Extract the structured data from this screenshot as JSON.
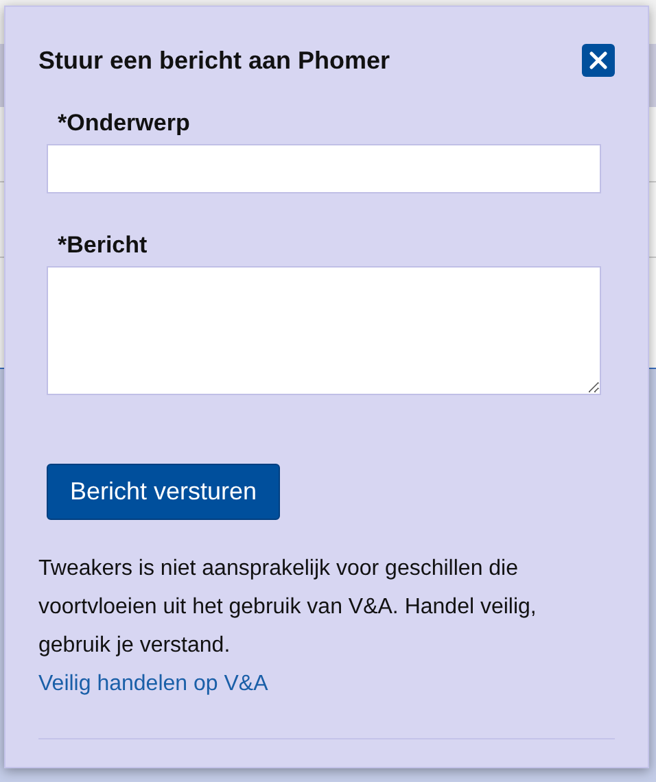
{
  "dialog": {
    "title": "Stuur een bericht aan Phomer",
    "fields": [
      {
        "kind": "input",
        "label": "*Onderwerp"
      },
      {
        "kind": "textarea",
        "label": "*Bericht"
      }
    ],
    "submit": "Bericht versturen",
    "disclaimer": "Tweakers is niet aansprakelijk voor geschillen die voortvloeien uit het gebruik van V&A. Handel veilig, gebruik je verstand.",
    "link": "Veilig handelen op V&A"
  }
}
